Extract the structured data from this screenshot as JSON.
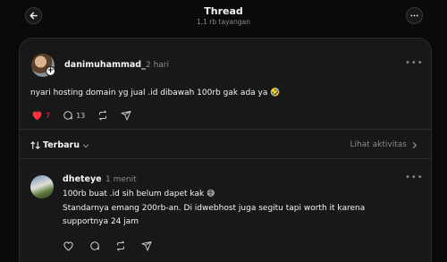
{
  "header": {
    "title": "Thread",
    "subtitle": "1,1 rb tayangan"
  },
  "post": {
    "username": "danimuhammad_",
    "time": "2 hari",
    "text": "nyari hosting domain yg jual .id dibawah 100rb gak ada ya 🤣",
    "likes": "7",
    "comments": "13",
    "liked": true
  },
  "replies_bar": {
    "sort_label": "Terbaru",
    "activity_label": "Lihat aktivitas"
  },
  "reply": {
    "username": "dheteye",
    "time": "1 menit",
    "line1": "100rb buat .id sih belum dapet kak 😅",
    "line2": "Standarnya emang 200rb-an. Di idwebhost juga segitu tapi worth it karena",
    "line3": "supportnya 24 jam"
  },
  "colors": {
    "background": "#0a0a0a",
    "card": "#181818",
    "like": "#ff3040",
    "muted": "#8c8c8c"
  }
}
